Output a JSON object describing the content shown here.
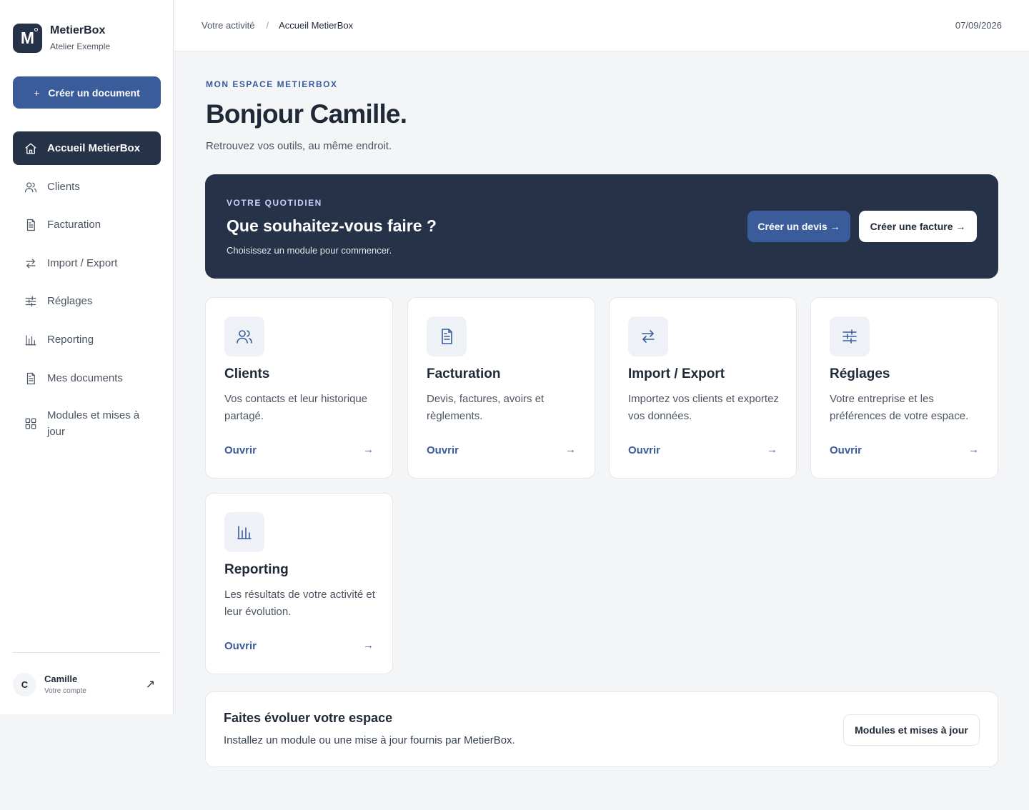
{
  "brand": {
    "name": "MetierBox",
    "subtitle": "Atelier Exemple",
    "logo_letter": "M"
  },
  "sidebar": {
    "create_button": {
      "icon": "+",
      "label": "Créer un document"
    },
    "items": [
      {
        "label": "Accueil MetierBox",
        "icon": "home-icon",
        "active": true
      },
      {
        "label": "Clients",
        "icon": "users-icon"
      },
      {
        "label": "Facturation",
        "icon": "document-icon"
      },
      {
        "label": "Import / Export",
        "icon": "arrows-exchange-icon"
      },
      {
        "label": "Réglages",
        "icon": "sliders-icon"
      },
      {
        "label": "Reporting",
        "icon": "bar-chart-icon"
      },
      {
        "label": "Mes documents",
        "icon": "document-icon"
      },
      {
        "label": "Modules et mises à jour",
        "icon": "grid-icon"
      }
    ],
    "account": {
      "initial": "C",
      "name": "Camille",
      "subtitle": "Votre compte",
      "arrow": "↗"
    }
  },
  "topbar": {
    "breadcrumb": [
      "Votre activité",
      "Accueil MetierBox"
    ],
    "separator": "/",
    "date": "07/09/2026"
  },
  "main": {
    "eyebrow": "MON ESPACE METIERBOX",
    "title": "Bonjour Camille.",
    "subtitle": "Retrouvez vos outils, au même endroit."
  },
  "hero": {
    "eyebrow": "VOTRE QUOTIDIEN",
    "title": "Que souhaitez-vous faire ?",
    "subtitle": "Choisissez un module pour commencer.",
    "primary_button": "Créer un devis →",
    "secondary_button": "Créer une facture →"
  },
  "modules": [
    {
      "title": "Clients",
      "description": "Vos contacts et leur historique partagé.",
      "open": "Ouvrir",
      "arrow": "→",
      "icon": "users-icon"
    },
    {
      "title": "Facturation",
      "description": "Devis, factures, avoirs et règlements.",
      "open": "Ouvrir",
      "arrow": "→",
      "icon": "document-icon"
    },
    {
      "title": "Import / Export",
      "description": "Importez vos clients et exportez vos données.",
      "open": "Ouvrir",
      "arrow": "→",
      "icon": "arrows-exchange-icon"
    },
    {
      "title": "Réglages",
      "description": "Votre entreprise et les préférences de votre espace.",
      "open": "Ouvrir",
      "arrow": "→",
      "icon": "sliders-icon"
    },
    {
      "title": "Reporting",
      "description": "Les résultats de votre activité et leur évolution.",
      "open": "Ouvrir",
      "arrow": "→",
      "icon": "bar-chart-icon"
    }
  ],
  "evolve": {
    "title": "Faites évoluer votre espace",
    "subtitle": "Installez un module ou une mise à jour fournis par MetierBox.",
    "button": "Modules et mises à jour"
  },
  "colors": {
    "navy": "#263248",
    "accent": "#3a5c9a",
    "background": "#f4f5f7"
  }
}
